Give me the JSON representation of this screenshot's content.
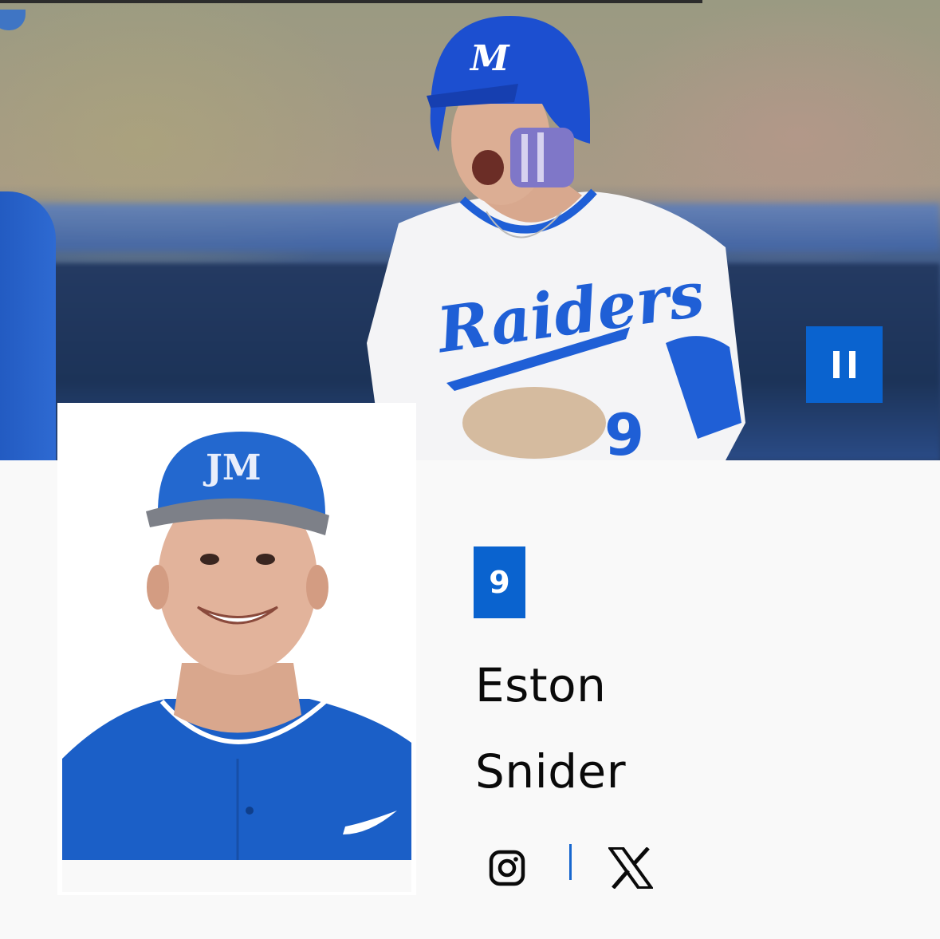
{
  "hero": {
    "pause_button_label": "Pause",
    "jersey_script": "Raiders",
    "jersey_number": "9",
    "helmet_logo": "M"
  },
  "player": {
    "number": "9",
    "first_name": "Eston",
    "last_name": "Snider"
  },
  "social": {
    "instagram_icon": "instagram-icon",
    "x_icon": "x-icon"
  },
  "colors": {
    "accent": "#0a63cf",
    "page_background": "#f9f9f9",
    "text": "#0a0a0a",
    "divider": "#1767cf"
  }
}
